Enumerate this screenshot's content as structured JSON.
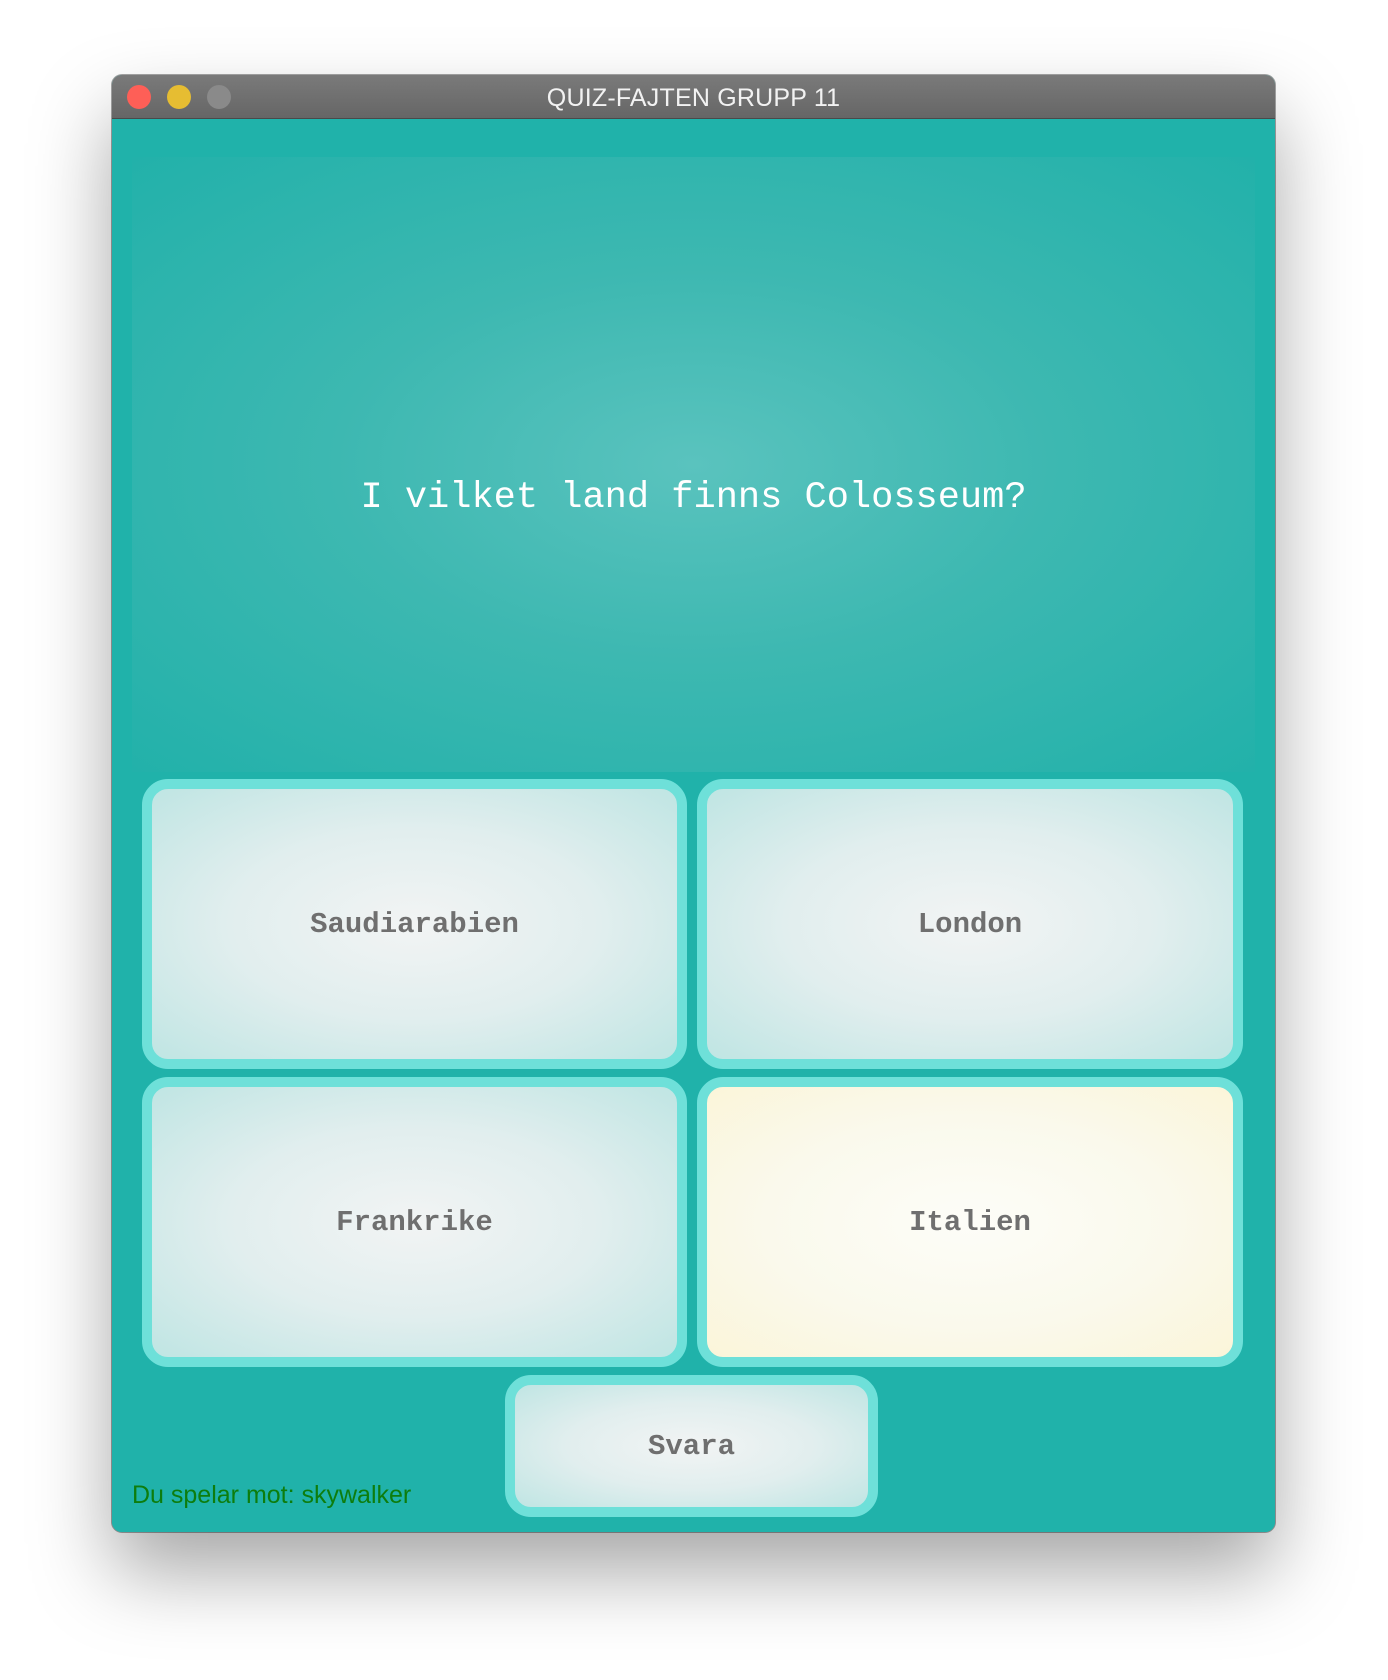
{
  "window": {
    "title": "QUIZ-FAJTEN GRUPP 11"
  },
  "question": {
    "text": "I vilket land finns Colosseum?"
  },
  "answers": [
    {
      "label": "Saudiarabien",
      "selected": false
    },
    {
      "label": "London",
      "selected": false
    },
    {
      "label": "Frankrike",
      "selected": false
    },
    {
      "label": "Italien",
      "selected": true
    }
  ],
  "submit": {
    "label": "Svara"
  },
  "status": {
    "opponent_text": "Du spelar mot: skywalker"
  },
  "colors": {
    "background": "#20b2aa",
    "button_border": "#6ee0d9",
    "selected_fill": "#faf9ec",
    "button_text": "#6f6f6f",
    "status_text": "#0d7d0d"
  },
  "icons": {
    "close": "close-traffic-light-icon",
    "minimize": "minimize-traffic-light-icon",
    "maximize": "maximize-traffic-light-icon"
  }
}
